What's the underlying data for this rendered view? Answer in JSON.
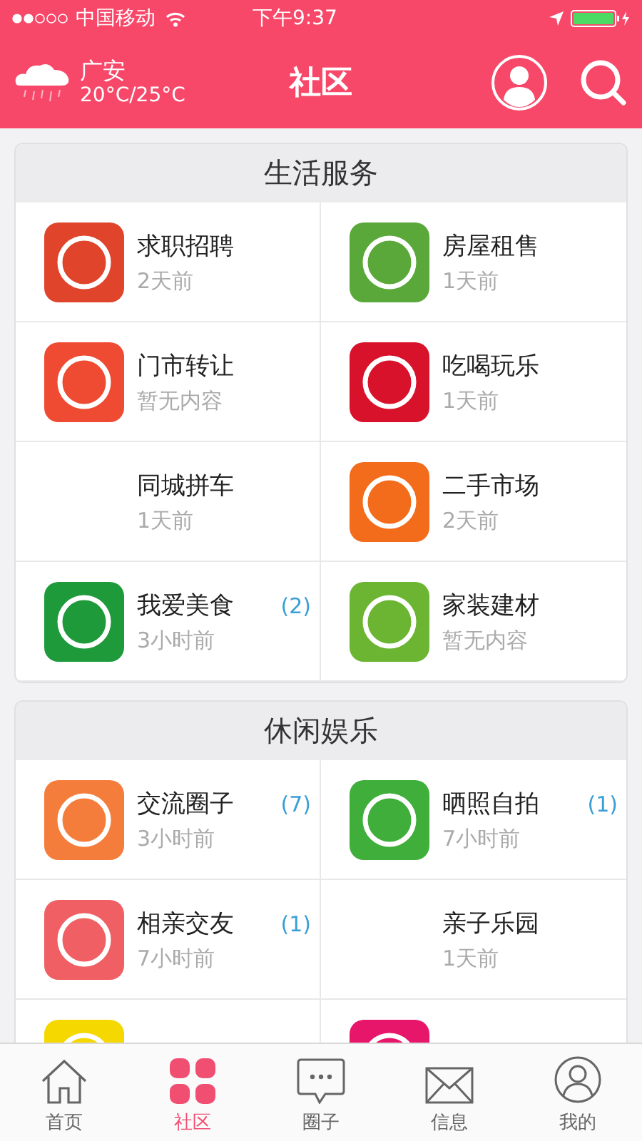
{
  "status_bar": {
    "carrier": "中国移动",
    "time": "下午9:37"
  },
  "header": {
    "city": "广安",
    "temperature": "20°C/25°C",
    "title": "社区"
  },
  "sections": [
    {
      "title": "生活服务",
      "items": [
        {
          "kind": "icon",
          "color": "#e0452c",
          "title": "求职招聘",
          "subtitle": "2天前"
        },
        {
          "kind": "icon",
          "color": "#5aa83a",
          "title": "房屋租售",
          "subtitle": "1天前"
        },
        {
          "kind": "icon",
          "color": "#ef4a32",
          "title": "门市转让",
          "subtitle": "暂无内容"
        },
        {
          "kind": "icon",
          "color": "#d8122b",
          "title": "吃喝玩乐",
          "subtitle": "1天前"
        },
        {
          "kind": "plain",
          "title": "同城拼车",
          "subtitle": "1天前"
        },
        {
          "kind": "icon",
          "color": "#f26c1c",
          "title": "二手市场",
          "subtitle": "2天前"
        },
        {
          "kind": "icon",
          "color": "#1f9a3a",
          "title": "我爱美食",
          "subtitle": "3小时前",
          "badge": "(2)"
        },
        {
          "kind": "icon",
          "color": "#6cb533",
          "title": "家装建材",
          "subtitle": "暂无内容"
        }
      ]
    },
    {
      "title": "休闲娱乐",
      "items": [
        {
          "kind": "icon",
          "color": "#f57d3c",
          "title": "交流圈子",
          "subtitle": "3小时前",
          "badge": "(7)"
        },
        {
          "kind": "icon",
          "color": "#3fae3a",
          "title": "晒照自拍",
          "subtitle": "7小时前",
          "badge": "(1)"
        },
        {
          "kind": "icon",
          "color": "#ef5f63",
          "title": "相亲交友",
          "subtitle": "7小时前",
          "badge": "(1)"
        },
        {
          "kind": "plain",
          "title": "亲子乐园",
          "subtitle": "1天前"
        },
        {
          "kind": "icon",
          "color": "#f5d800"
        },
        {
          "kind": "icon",
          "color": "#e8166b"
        }
      ]
    }
  ],
  "tab_bar": [
    {
      "label": "首页",
      "selected": false
    },
    {
      "label": "社区",
      "selected": true
    },
    {
      "label": "圈子",
      "selected": false
    },
    {
      "label": "信息",
      "selected": false
    },
    {
      "label": "我的",
      "selected": false
    }
  ]
}
